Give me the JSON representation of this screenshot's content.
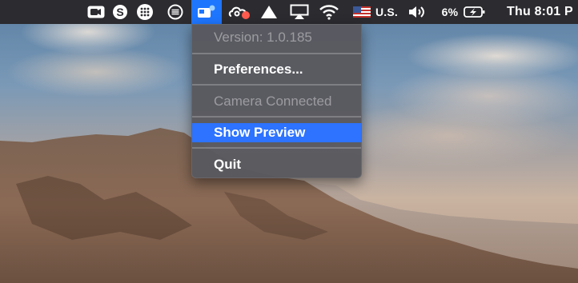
{
  "menubar": {
    "input_source": "U.S.",
    "battery_percent": "6%",
    "clock": "Thu 8:01 P"
  },
  "app_menu": {
    "version": "Version: 1.0.185",
    "preferences": "Preferences...",
    "camera_status": "Camera Connected",
    "show_preview": "Show Preview",
    "quit": "Quit"
  },
  "colors": {
    "menubar_bg": "#2b2b30",
    "menu_bg": "#58585e",
    "highlight": "#2d73ff",
    "active_status_item": "#1e76ff"
  },
  "icons": [
    "video-camera-icon",
    "skype-icon",
    "dialpad-icon",
    "spotify-like-icon",
    "webcam-app-icon",
    "creative-cloud-icon",
    "google-drive-icon",
    "airplay-icon",
    "wifi-icon",
    "us-flag-icon",
    "volume-icon",
    "battery-charging-icon"
  ]
}
